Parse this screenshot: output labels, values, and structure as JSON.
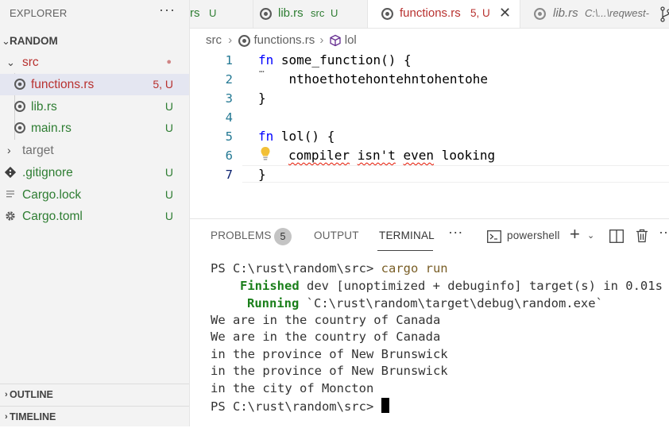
{
  "explorer": {
    "title": "EXPLORER",
    "more": "···",
    "root": "RANDOM",
    "items": [
      {
        "label": "src",
        "status": "●"
      },
      {
        "label": "functions.rs",
        "status": "5, U"
      },
      {
        "label": "lib.rs",
        "status": "U"
      },
      {
        "label": "main.rs",
        "status": "U"
      },
      {
        "label": "target",
        "status": ""
      },
      {
        "label": ".gitignore",
        "status": "U"
      },
      {
        "label": "Cargo.lock",
        "status": "U"
      },
      {
        "label": "Cargo.toml",
        "status": "U"
      }
    ],
    "outline": "OUTLINE",
    "timeline": "TIMELINE"
  },
  "tabs": [
    {
      "label": "rs",
      "status": "U"
    },
    {
      "label": "lib.rs",
      "path": "src",
      "status": "U"
    },
    {
      "label": "functions.rs",
      "status": "5, U"
    },
    {
      "label": "lib.rs",
      "path": "C:\\...\\reqwest-"
    }
  ],
  "breadcrumb": {
    "folder": "src",
    "file": "functions.rs",
    "symbol": "lol"
  },
  "editor": {
    "line_numbers": [
      "1",
      "2",
      "3",
      "4",
      "5",
      "6",
      "7"
    ],
    "lines": {
      "l1_kw": "fn",
      "l1_rest": " some_function() {",
      "l2": "    nthoethotehontehntohentohe",
      "l3": "}",
      "l5_kw": "fn",
      "l5_rest": " lol() {",
      "l6_w1": "compiler",
      "l6_w2": "isn't",
      "l6_w3": "even",
      "l6_w4": "looking",
      "l7": "}"
    }
  },
  "panel": {
    "tabs": {
      "problems": "PROBLEMS",
      "problems_count": "5",
      "output": "OUTPUT",
      "terminal": "TERMINAL",
      "more": "···"
    },
    "shell": "powershell",
    "terminal_lines": {
      "prompt1": "PS C:\\rust\\random\\src> ",
      "cmd": "cargo run",
      "fin_word": "Finished",
      "fin_rest": " dev [unoptimized + debuginfo] target(s) in 0.01s",
      "run_word": "Running",
      "run_rest": " `C:\\rust\\random\\target\\debug\\random.exe`",
      "out1": "We are in the country of Canada",
      "out2": "We are in the country of Canada",
      "out3": "in the province of New Brunswick",
      "out4": "in the province of New Brunswick",
      "out5": "in the city of Moncton",
      "prompt2": "PS C:\\rust\\random\\src> "
    }
  },
  "colors": {
    "git_untracked": "#2e7d32",
    "error_file": "#b8312f",
    "accent_keyword": "#0000ff",
    "selection": "#e4e6f1"
  }
}
